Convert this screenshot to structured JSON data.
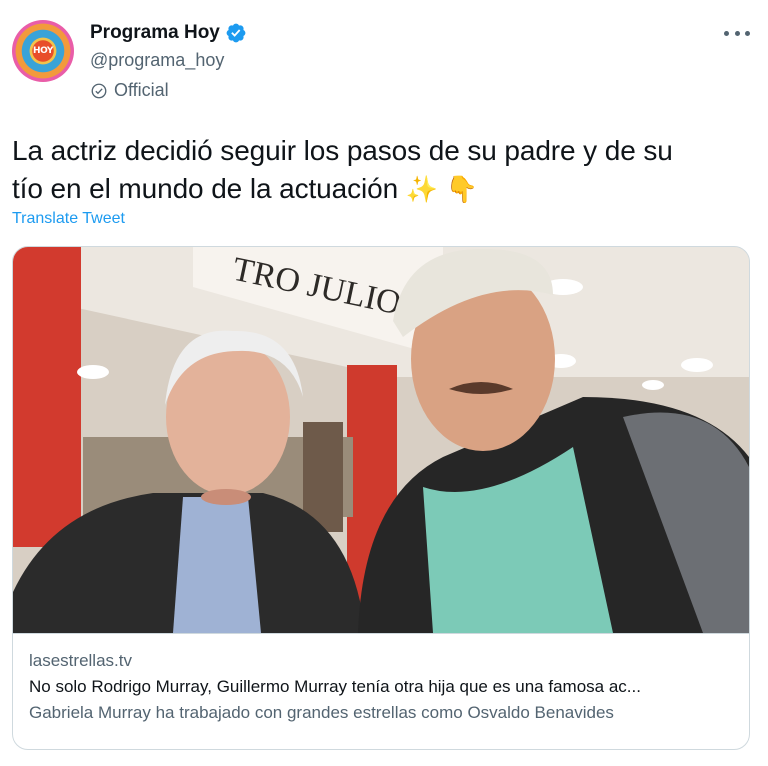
{
  "tweet": {
    "author": {
      "display_name": "Programa Hoy",
      "handle": "@programa_hoy",
      "official_label": "Official",
      "avatar_text": "HOY"
    },
    "text_line1": "La actriz decidió seguir los pasos de su padre y de su",
    "text_line2": "tío en el mundo de la actuación",
    "emojis": [
      "✨",
      "👇"
    ],
    "translate_label": "Translate Tweet"
  },
  "card": {
    "photo_sign_text": "TRO JULIO",
    "domain": "lasestrellas.tv",
    "title": "No solo Rodrigo Murray, Guillermo Murray tenía otra hija que es una famosa ac...",
    "description": "Gabriela Murray ha trabajado con grandes estrellas como Osvaldo Benavides"
  },
  "colors": {
    "link": "#1d9bf0",
    "secondary_text": "#536471",
    "primary_text": "#0f1419",
    "border": "#cfd9de"
  },
  "icons": {
    "verified": "verified-badge-icon",
    "official": "check-circle-icon",
    "more": "more-dots-icon"
  }
}
